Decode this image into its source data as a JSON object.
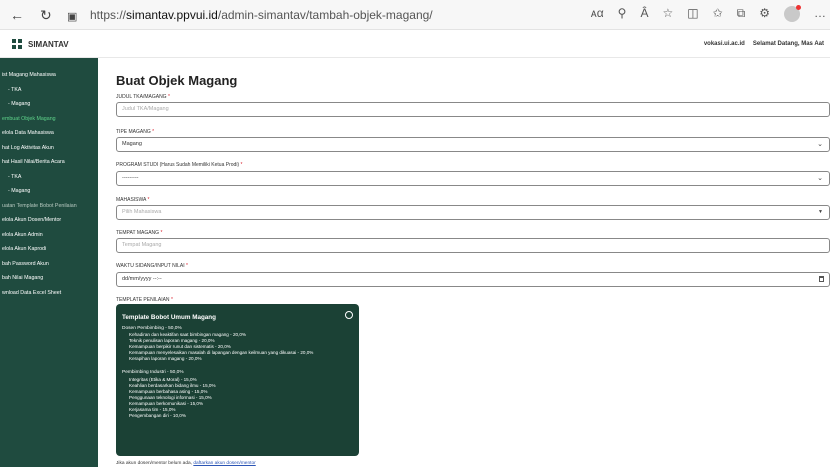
{
  "browser": {
    "url_prefix": "https://",
    "url_host": "simantav.ppvui.id",
    "url_path": "/admin-simantav/tambah-objek-magang/",
    "tools": [
      "áa",
      "⌕",
      "A₀",
      "☆",
      "▯",
      "★",
      "⧉",
      "⌘",
      "…"
    ]
  },
  "app": {
    "brand": "SIMANTAV",
    "domain_link": "vokasi.ui.ac.id",
    "greeting": "Selamat Datang, Mas Aat"
  },
  "sidebar": {
    "items": [
      {
        "label": "ist Magang Mahasiswa",
        "sub": false,
        "active": false
      },
      {
        "label": "- TKA",
        "sub": true,
        "active": false
      },
      {
        "label": "- Magang",
        "sub": true,
        "active": false
      },
      {
        "label": "embuat Objek Magang",
        "sub": false,
        "active": true
      },
      {
        "label": "elola Data Mahasiswa",
        "sub": false,
        "active": false
      },
      {
        "label": "hat Log Aktivitas Akun",
        "sub": false,
        "active": false
      },
      {
        "label": "hat Hasil Nilai/Berita Acara",
        "sub": false,
        "active": false
      },
      {
        "label": "- TKA",
        "sub": true,
        "active": false
      },
      {
        "label": "- Magang",
        "sub": true,
        "active": false
      },
      {
        "label": "uatan Template Bobot Penilaian",
        "sub": false,
        "active": false,
        "muted": true
      },
      {
        "label": "elola Akun Dosen/Mentor",
        "sub": false,
        "active": false
      },
      {
        "label": "elola Akun Admin",
        "sub": false,
        "active": false
      },
      {
        "label": "elola Akun Kaprodi",
        "sub": false,
        "active": false
      },
      {
        "label": "bah Password Akun",
        "sub": false,
        "active": false
      },
      {
        "label": "bah Nilai Magang",
        "sub": false,
        "active": false
      },
      {
        "label": "wnload Data Excel Sheet",
        "sub": false,
        "active": false
      }
    ]
  },
  "form": {
    "title": "Buat Objek Magang",
    "required_mark": "*",
    "judul": {
      "label": "JUDUL TKA/MAGANG",
      "placeholder": "Judul TKA/Magang"
    },
    "tipe": {
      "label": "TIPE MAGANG",
      "value": "Magang"
    },
    "prodi": {
      "label": "PROGRAM STUDI (Harus Sudah Memiliki Ketua Prodi)",
      "value": "---------"
    },
    "mahasiswa": {
      "label": "MAHASISWA",
      "placeholder": "Pilih Mahasiswa"
    },
    "tempat": {
      "label": "TEMPAT MAGANG",
      "placeholder": "Tempat Magang"
    },
    "waktu": {
      "label": "WAKTU SIDANG/INPUT NILAI",
      "value": "dd/mm/yyyy --:--"
    },
    "template": {
      "label": "TEMPLATE PENILAIAN"
    }
  },
  "template_card": {
    "title": "Template Bobot Umum Magang",
    "groups": [
      {
        "heading": "Dosen Pembimbing - 50,0%",
        "criteria": [
          "Kehadiran dan keaktifan saat bimbingan magang - 20,0%",
          "Teknik penulisan laporan magang - 20,0%",
          "Kemampuan berpikir runut dan sistematis - 20,0%",
          "Kemampuan menyelesaikan masalah di lapangan dengan keilmuan yang dikuasai - 20,0%",
          "Kerapihan laporan magang - 20,0%"
        ]
      },
      {
        "heading": "Pembimbing Industri - 50,0%",
        "criteria": [
          "Integritas (Etika & Moral) - 15,0%",
          "Keahlian berdasarkan bidang ilmu - 15,0%",
          "Kemampuan berbahasa asing - 15,0%",
          "Penggunaan teknologi informasi - 15,0%",
          "Kemampuan berkomunikasi - 15,0%",
          "Kerjasama tim - 15,0%",
          "Pengembangan diri - 10,0%"
        ]
      }
    ]
  },
  "footer_note": {
    "text": "Jika akun dosen/mentor belum ada,",
    "link": "daftarkan akun dosen/mentor"
  }
}
